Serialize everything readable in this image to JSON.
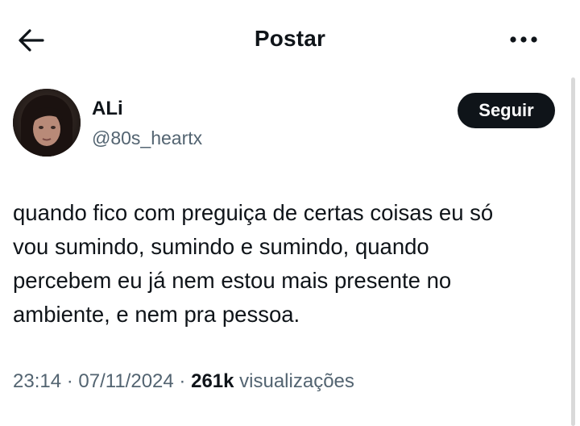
{
  "header": {
    "title": "Postar",
    "back_icon": "arrow-left-icon",
    "more_icon": "more-horizontal-icon"
  },
  "author": {
    "name": "ALi",
    "handle": "@80s_heartx",
    "follow_label": "Seguir"
  },
  "post": {
    "lines": [
      "quando fico com preguiça de certas coisas eu só",
      "vou sumindo, sumindo e sumindo, quando",
      "percebem eu já nem estou mais presente no",
      "ambiente, e nem pra pessoa."
    ],
    "time": "23:14",
    "date": "07/11/2024",
    "views_count": "261k",
    "views_label": "visualizações"
  },
  "colors": {
    "text": "#0f1419",
    "secondary": "#536471",
    "button_bg": "#0f1419",
    "button_text": "#ffffff"
  }
}
